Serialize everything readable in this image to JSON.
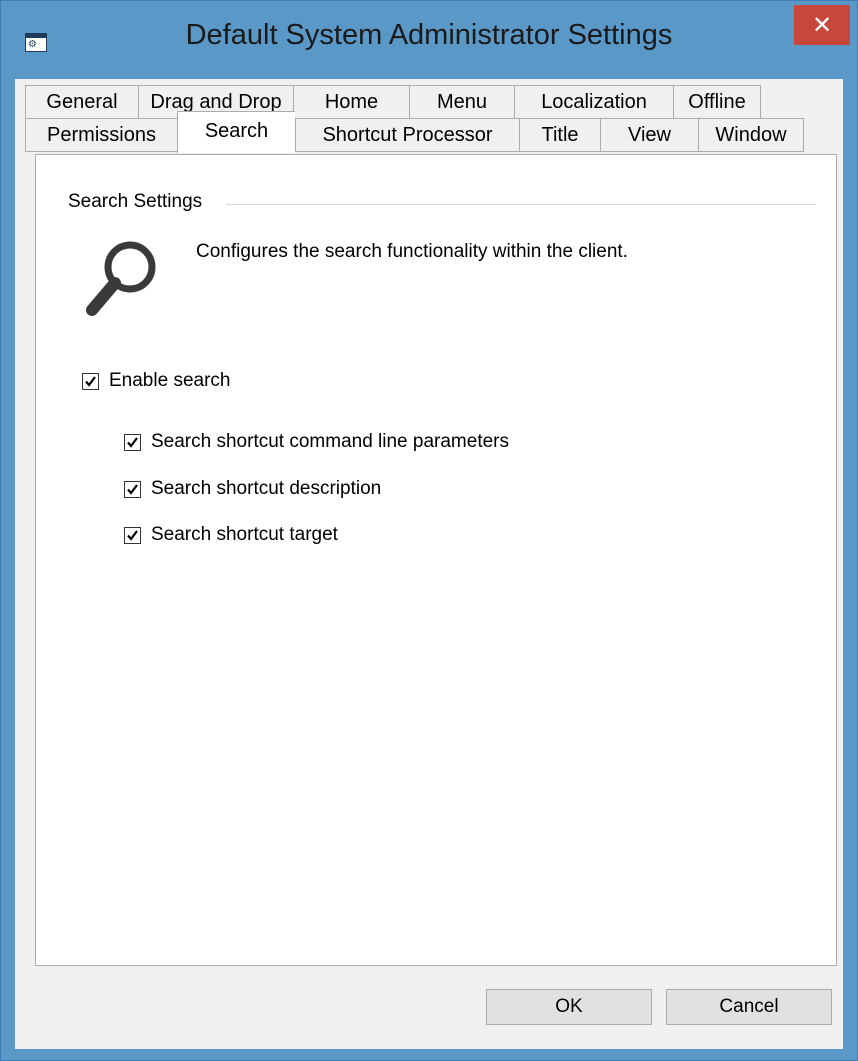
{
  "window": {
    "title": "Default System Administrator Settings",
    "close_glyph": "✕",
    "icon": "settings-window-icon",
    "colors": {
      "titlebar": "#5a98c8",
      "close": "#c7473a",
      "client": "#f0f0f0"
    }
  },
  "tabs": {
    "row1": [
      "General",
      "Drag and Drop",
      "Home",
      "Menu",
      "Localization",
      "Offline"
    ],
    "row2": [
      "Permissions",
      "Search",
      "Shortcut Processor",
      "Title",
      "View",
      "Window"
    ],
    "selected": "Search"
  },
  "panel": {
    "group_label": "Search Settings",
    "icon": "search-icon",
    "description": "Configures the search functionality within the client.",
    "enable_search": {
      "label": "Enable search",
      "checked": true
    },
    "options": [
      {
        "label": "Search shortcut command line parameters",
        "checked": true
      },
      {
        "label": "Search shortcut description",
        "checked": true
      },
      {
        "label": "Search shortcut target",
        "checked": true
      }
    ]
  },
  "buttons": {
    "ok": "OK",
    "cancel": "Cancel"
  }
}
